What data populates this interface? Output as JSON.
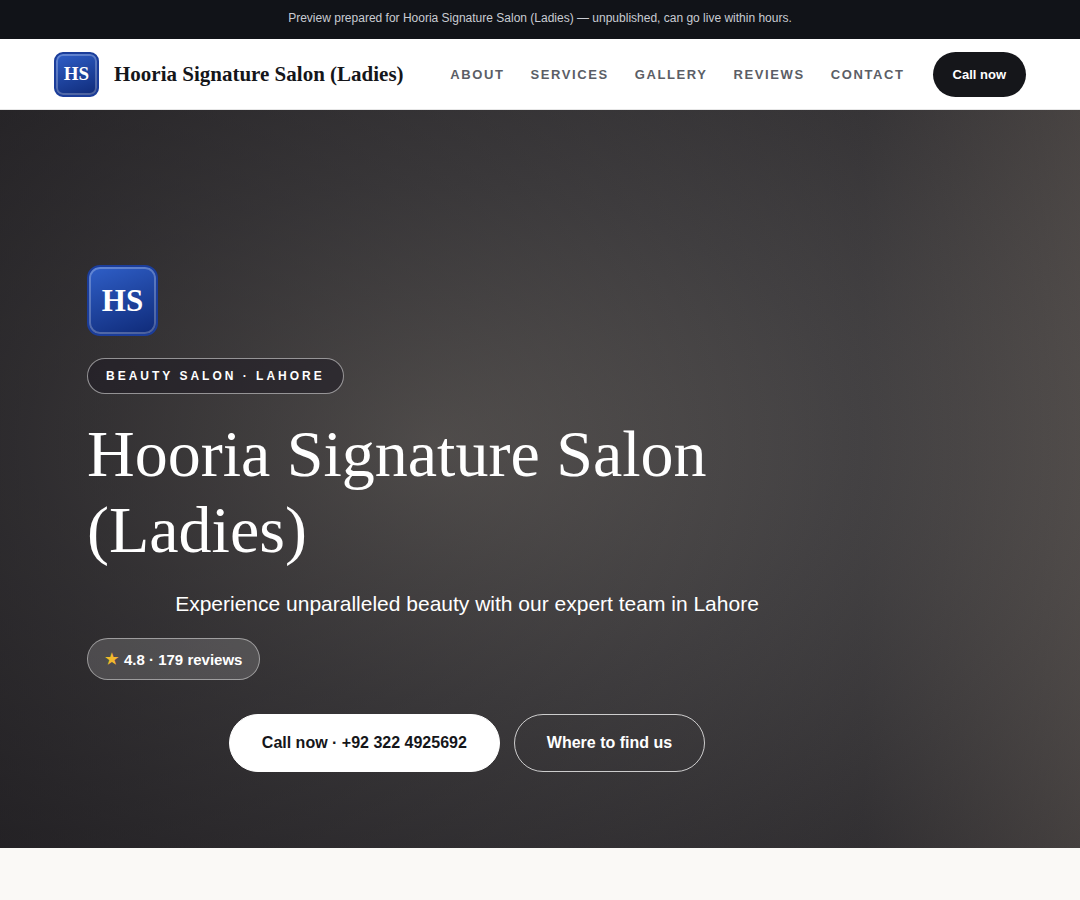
{
  "banner": {
    "text": "Preview prepared for Hooria Signature Salon (Ladies) — unpublished, can go live within hours."
  },
  "header": {
    "logo": "HS",
    "brand": "Hooria Signature Salon (Ladies)",
    "nav": [
      {
        "label": "ABOUT",
        "selected": false
      },
      {
        "label": "SERVICES",
        "selected": false
      },
      {
        "label": "GALLERY",
        "selected": false
      },
      {
        "label": "REVIEWS",
        "selected": false
      },
      {
        "label": "CONTACT",
        "selected": false
      }
    ],
    "call_button": "Call now"
  },
  "hero": {
    "logo": "HS",
    "badge": "BEAUTY SALON · LAHORE",
    "title": "Hooria Signature Salon (Ladies)",
    "subtitle": "Experience unparalleled beauty with our expert team in Lahore",
    "rating": {
      "star": "★",
      "text": "4.8 · 179 reviews"
    },
    "buttons": [
      {
        "label": "Call now · +92 322 4925692",
        "kind": "primary"
      },
      {
        "label": "Where to find us",
        "kind": "outline"
      }
    ]
  }
}
